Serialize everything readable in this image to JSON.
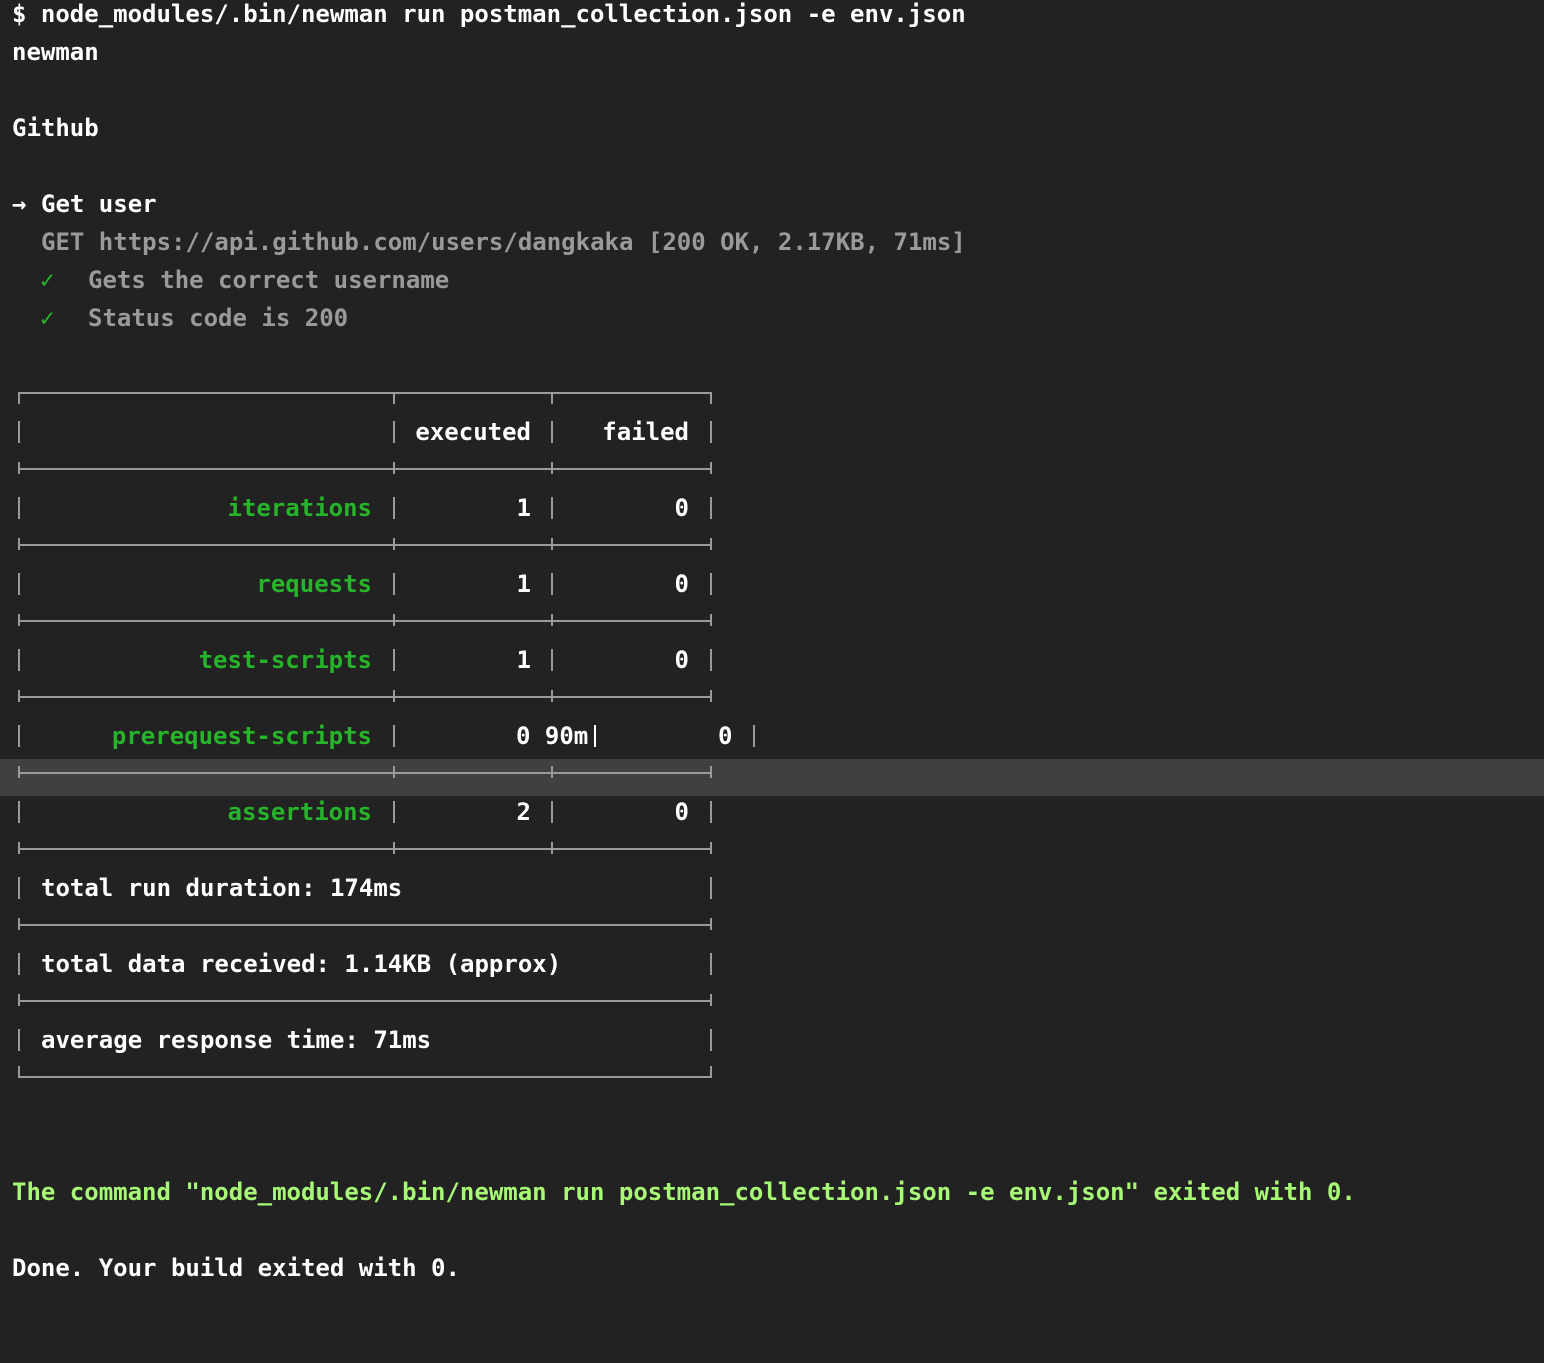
{
  "terminal": {
    "command_line": "$ node_modules/.bin/newman run postman_collection.json -e env.json",
    "newman_label": "newman",
    "collection_name": "Github",
    "request": {
      "arrow": "→",
      "name": "Get user",
      "detail": "GET https://api.github.com/users/dangkaka [200 OK, 2.17KB, 71ms]",
      "tests": [
        {
          "check": "✓",
          "label": "Gets the correct username"
        },
        {
          "check": "✓",
          "label": "Status code is 200"
        }
      ]
    },
    "summary_table": {
      "headers": [
        "",
        "executed",
        "failed"
      ],
      "rows": [
        {
          "label": "iterations",
          "executed": "1",
          "failed": "0"
        },
        {
          "label": "requests",
          "executed": "1",
          "failed": "0"
        },
        {
          "label": "test-scripts",
          "executed": "1",
          "failed": "0"
        },
        {
          "label": "prerequest-scripts",
          "executed": "0 90m",
          "failed": "0"
        },
        {
          "label": "assertions",
          "executed": "2",
          "failed": "0"
        }
      ],
      "footer": [
        "total run duration: 174ms",
        "total data received: 1.14KB (approx)",
        "average response time: 71ms"
      ]
    },
    "exit_message": "The command \"node_modules/.bin/newman run postman_collection.json -e env.json\" exited with 0.",
    "done_message": "Done. Your build exited with 0."
  },
  "colors": {
    "background": "#222222",
    "text": "#ffffff",
    "green": "#27b32a",
    "bright_green": "#a8fa76",
    "border": "#9a9a9a",
    "highlight": "#404040"
  }
}
